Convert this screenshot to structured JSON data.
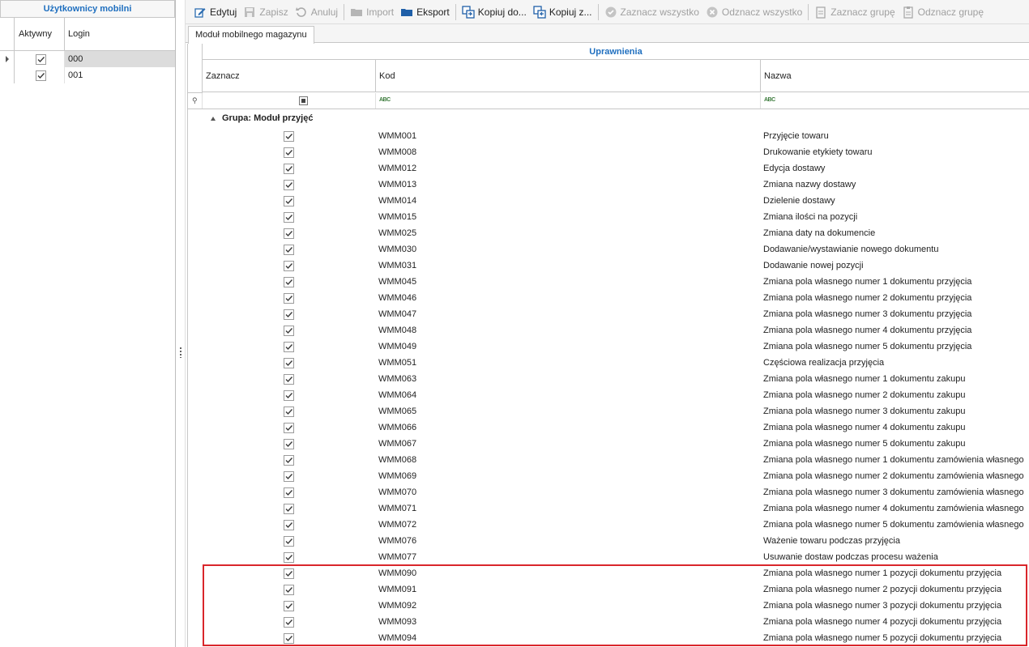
{
  "left_panel": {
    "title": "Użytkownicy mobilni",
    "col_aktywny": "Aktywny",
    "col_login": "Login",
    "users": [
      {
        "login": "000",
        "active": true,
        "selected": true
      },
      {
        "login": "001",
        "active": true,
        "selected": false
      }
    ]
  },
  "toolbar": {
    "edit": "Edytuj",
    "save": "Zapisz",
    "cancel": "Anuluj",
    "import": "Import",
    "export": "Eksport",
    "copy_to": "Kopiuj do...",
    "copy_from": "Kopiuj z...",
    "select_all": "Zaznacz wszystko",
    "deselect_all": "Odznacz wszystko",
    "select_group": "Zaznacz grupę",
    "deselect_group": "Odznacz grupę"
  },
  "tab": {
    "label": "Moduł mobilnego magazynu"
  },
  "grid": {
    "band_title": "Uprawnienia",
    "col_zaznacz": "Zaznacz",
    "col_kod": "Kod",
    "col_nazwa": "Nazwa",
    "group_label": "Grupa: Moduł przyjęć",
    "rows": [
      {
        "kod": "WMM001",
        "nazwa": "Przyjęcie towaru"
      },
      {
        "kod": "WMM008",
        "nazwa": "Drukowanie etykiety towaru"
      },
      {
        "kod": "WMM012",
        "nazwa": "Edycja dostawy"
      },
      {
        "kod": "WMM013",
        "nazwa": "Zmiana nazwy dostawy"
      },
      {
        "kod": "WMM014",
        "nazwa": "Dzielenie dostawy"
      },
      {
        "kod": "WMM015",
        "nazwa": "Zmiana ilości na pozycji"
      },
      {
        "kod": "WMM025",
        "nazwa": "Zmiana daty na dokumencie"
      },
      {
        "kod": "WMM030",
        "nazwa": "Dodawanie/wystawianie nowego dokumentu"
      },
      {
        "kod": "WMM031",
        "nazwa": "Dodawanie nowej pozycji"
      },
      {
        "kod": "WMM045",
        "nazwa": "Zmiana pola własnego numer 1 dokumentu przyjęcia"
      },
      {
        "kod": "WMM046",
        "nazwa": "Zmiana pola własnego numer 2 dokumentu przyjęcia"
      },
      {
        "kod": "WMM047",
        "nazwa": "Zmiana pola własnego numer 3 dokumentu przyjęcia"
      },
      {
        "kod": "WMM048",
        "nazwa": "Zmiana pola własnego numer 4 dokumentu przyjęcia"
      },
      {
        "kod": "WMM049",
        "nazwa": "Zmiana pola własnego numer 5 dokumentu przyjęcia"
      },
      {
        "kod": "WMM051",
        "nazwa": "Częściowa realizacja przyjęcia"
      },
      {
        "kod": "WMM063",
        "nazwa": "Zmiana pola własnego numer 1 dokumentu zakupu"
      },
      {
        "kod": "WMM064",
        "nazwa": "Zmiana pola własnego numer 2 dokumentu zakupu"
      },
      {
        "kod": "WMM065",
        "nazwa": "Zmiana pola własnego numer 3 dokumentu zakupu"
      },
      {
        "kod": "WMM066",
        "nazwa": "Zmiana pola własnego numer 4 dokumentu zakupu"
      },
      {
        "kod": "WMM067",
        "nazwa": "Zmiana pola własnego numer 5 dokumentu zakupu"
      },
      {
        "kod": "WMM068",
        "nazwa": "Zmiana pola własnego numer 1 dokumentu zamówienia własnego"
      },
      {
        "kod": "WMM069",
        "nazwa": "Zmiana pola własnego numer 2 dokumentu zamówienia własnego"
      },
      {
        "kod": "WMM070",
        "nazwa": "Zmiana pola własnego numer 3 dokumentu zamówienia własnego"
      },
      {
        "kod": "WMM071",
        "nazwa": "Zmiana pola własnego numer 4 dokumentu zamówienia własnego"
      },
      {
        "kod": "WMM072",
        "nazwa": "Zmiana pola własnego numer 5 dokumentu zamówienia własnego"
      },
      {
        "kod": "WMM076",
        "nazwa": "Ważenie towaru podczas przyjęcia"
      },
      {
        "kod": "WMM077",
        "nazwa": "Usuwanie dostaw podczas procesu ważenia"
      },
      {
        "kod": "WMM090",
        "nazwa": "Zmiana pola własnego numer 1 pozycji dokumentu przyjęcia"
      },
      {
        "kod": "WMM091",
        "nazwa": "Zmiana pola własnego numer 2 pozycji dokumentu przyjęcia"
      },
      {
        "kod": "WMM092",
        "nazwa": "Zmiana pola własnego numer 3 pozycji dokumentu przyjęcia"
      },
      {
        "kod": "WMM093",
        "nazwa": "Zmiana pola własnego numer 4 pozycji dokumentu przyjęcia"
      },
      {
        "kod": "WMM094",
        "nazwa": "Zmiana pola własnego numer 5 pozycji dokumentu przyjęcia"
      }
    ]
  },
  "colors": {
    "accent": "#1f6fbf",
    "highlight": "#d9262b",
    "selected_row": "#dcdcdc"
  }
}
